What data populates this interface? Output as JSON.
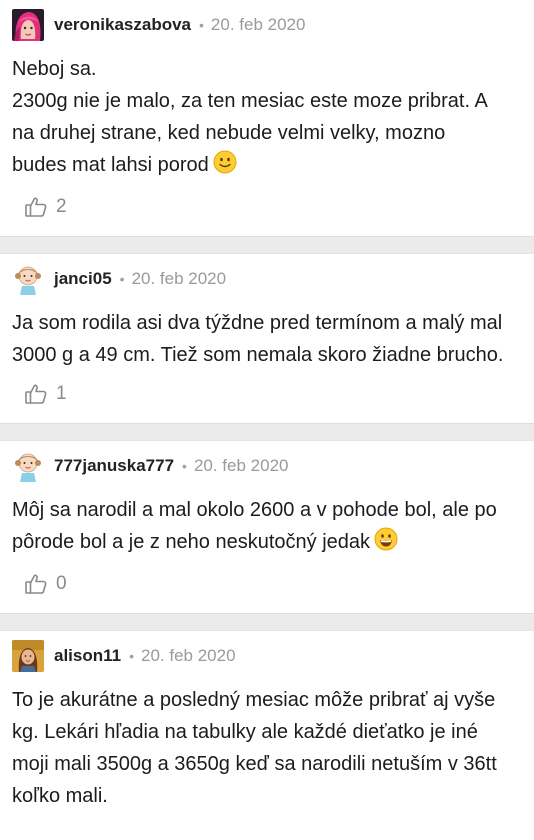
{
  "comments": [
    {
      "username": "veronikaszabova",
      "separator": "•",
      "date": "20. feb 2020",
      "avatar": "avatar-pink-hair",
      "lines": [
        "Neboj sa.",
        "2300g nie je malo, za ten mesiac este moze pribrat. A",
        "na druhej strane, ked nebude velmi velky, mozno",
        "budes mat lahsi porod"
      ],
      "emoji": "slight-smile-emoji",
      "likes": "2"
    },
    {
      "username": "janci05",
      "separator": "•",
      "date": "20. feb 2020",
      "avatar": "avatar-cartoon-girl",
      "lines": [
        "Ja som rodila asi dva týždne pred termínom a malý mal",
        "3000 g a 49 cm. Tiež som nemala skoro žiadne brucho."
      ],
      "likes": "1"
    },
    {
      "username": "777januska777",
      "separator": "•",
      "date": "20. feb 2020",
      "avatar": "avatar-cartoon-girl",
      "lines": [
        "Môj sa narodil a mal okolo 2600 a v pohode bol, ale po",
        "pôrode bol a je z neho neskutočný jedak"
      ],
      "emoji": "grin-emoji",
      "likes": "0"
    },
    {
      "username": "alison11",
      "separator": "•",
      "date": "20. feb 2020",
      "avatar": "avatar-photo",
      "lines": [
        "To je akurátne a posledný mesiac môže pribrať aj vyše",
        "kg. Lekári hľadia na tabulky ale každé dieťatko je iné",
        "moji mali 3500g a 3650g keď sa narodili netuším v 36tt",
        "koľko mali."
      ]
    }
  ],
  "colors": {
    "divider": "#ebebeb",
    "muted": "#9a9a9a",
    "text": "#1c1c1c"
  }
}
